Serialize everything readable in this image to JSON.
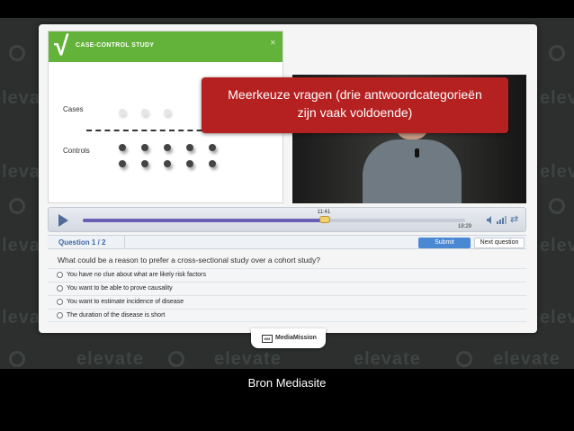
{
  "slide": {
    "title": "CASE-CONTROL STUDY",
    "cases_label": "Cases",
    "controls_label": "Controls"
  },
  "tooltip": {
    "line1": "Meerkeuze vragen (drie antwoordcategorieën",
    "line2": "zijn vaak voldoende)"
  },
  "player": {
    "current_time": "11:41",
    "duration": "18:29",
    "progress": 0.632
  },
  "quiz": {
    "question_number": "Question 1 / 2",
    "submit_label": "Submit",
    "next_label": "Next question",
    "question": "What could be a reason to prefer a cross-sectional study over a cohort study?",
    "options": [
      "You have no clue about what are likely risk factors",
      "You want to be able to prove causality",
      "You want to estimate incidence of disease",
      "The duration of the disease is short"
    ]
  },
  "brand": {
    "name": "MediaMission",
    "icon_text": "MM"
  },
  "background_word": "elevate",
  "caption": "Bron Mediasite",
  "colors": {
    "slide_header": "#63b23a",
    "tooltip": "#b52020",
    "accent_blue": "#4a88d4",
    "progress": "#6a5fb5"
  }
}
